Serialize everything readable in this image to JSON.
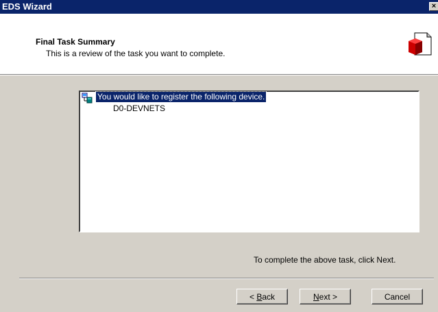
{
  "window": {
    "title": "EDS Wizard",
    "close_label": "×"
  },
  "header": {
    "title": "Final Task Summary",
    "subtitle": "This is a review of the task you want to complete.",
    "icon": "eds-wizard-icon"
  },
  "summary": {
    "root_label": "You would like to register the following device.",
    "devices": [
      "D0-DEVNETS"
    ]
  },
  "instruction": "To complete the above task, click Next.",
  "buttons": {
    "back": {
      "mnemonic": "B",
      "rest": "ack",
      "prefix": "< "
    },
    "next": {
      "mnemonic": "N",
      "rest": "ext",
      "suffix": " >"
    },
    "cancel": "Cancel"
  }
}
